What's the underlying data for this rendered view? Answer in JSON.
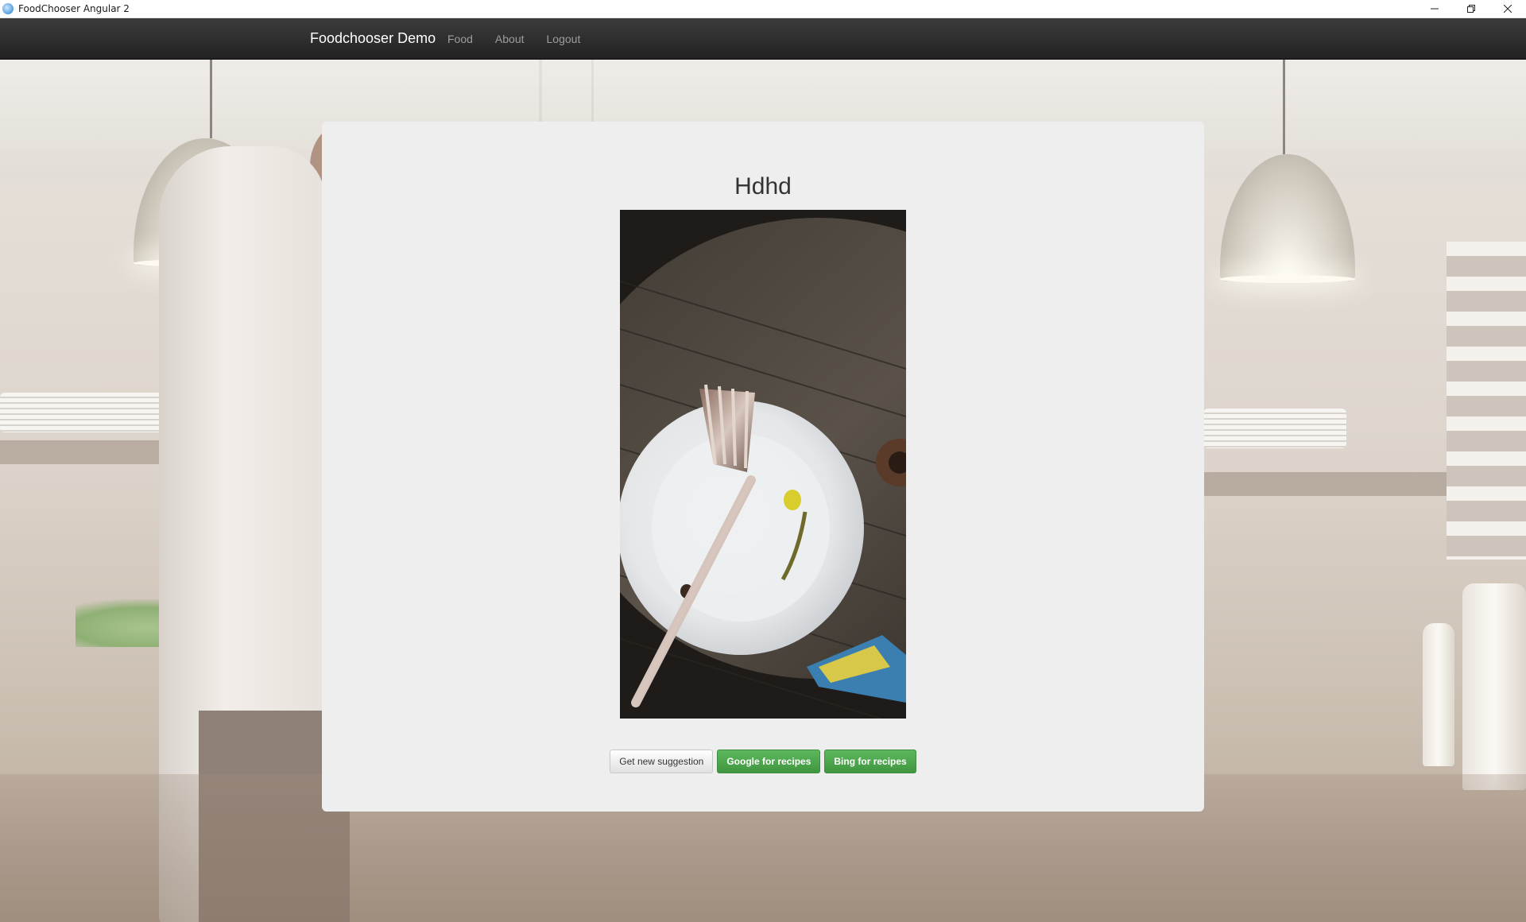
{
  "window": {
    "title": "FoodChooser Angular 2",
    "controls": [
      "minimize",
      "restore",
      "close"
    ]
  },
  "navbar": {
    "brand": "Foodchooser Demo",
    "links": [
      {
        "label": "Food"
      },
      {
        "label": "About"
      },
      {
        "label": "Logout"
      }
    ]
  },
  "main": {
    "food_name": "Hdhd",
    "photo_description_icon": "food-photo",
    "buttons": {
      "new_suggestion": "Get new suggestion",
      "google": "Google for recipes",
      "bing": "Bing for recipes"
    }
  },
  "colors": {
    "navbar": "#222222",
    "brand_text": "#ffffff",
    "nav_link": "#9d9d9d",
    "card": "#eeeeee",
    "success": "#5cb85c"
  }
}
